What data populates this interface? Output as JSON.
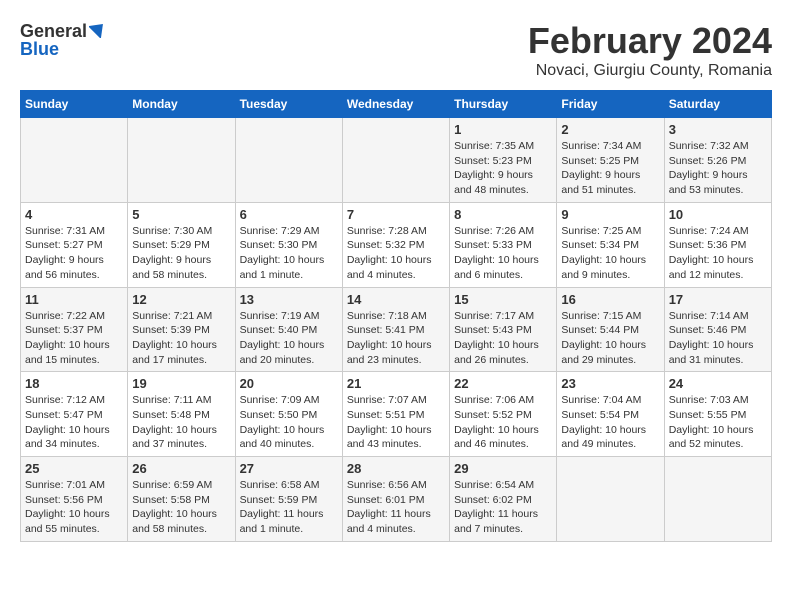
{
  "header": {
    "logo": {
      "general": "General",
      "blue": "Blue"
    },
    "title": "February 2024",
    "location": "Novaci, Giurgiu County, Romania"
  },
  "calendar": {
    "days_of_week": [
      "Sunday",
      "Monday",
      "Tuesday",
      "Wednesday",
      "Thursday",
      "Friday",
      "Saturday"
    ],
    "weeks": [
      [
        {
          "day": "",
          "info": ""
        },
        {
          "day": "",
          "info": ""
        },
        {
          "day": "",
          "info": ""
        },
        {
          "day": "",
          "info": ""
        },
        {
          "day": "1",
          "info": "Sunrise: 7:35 AM\nSunset: 5:23 PM\nDaylight: 9 hours and 48 minutes."
        },
        {
          "day": "2",
          "info": "Sunrise: 7:34 AM\nSunset: 5:25 PM\nDaylight: 9 hours and 51 minutes."
        },
        {
          "day": "3",
          "info": "Sunrise: 7:32 AM\nSunset: 5:26 PM\nDaylight: 9 hours and 53 minutes."
        }
      ],
      [
        {
          "day": "4",
          "info": "Sunrise: 7:31 AM\nSunset: 5:27 PM\nDaylight: 9 hours and 56 minutes."
        },
        {
          "day": "5",
          "info": "Sunrise: 7:30 AM\nSunset: 5:29 PM\nDaylight: 9 hours and 58 minutes."
        },
        {
          "day": "6",
          "info": "Sunrise: 7:29 AM\nSunset: 5:30 PM\nDaylight: 10 hours and 1 minute."
        },
        {
          "day": "7",
          "info": "Sunrise: 7:28 AM\nSunset: 5:32 PM\nDaylight: 10 hours and 4 minutes."
        },
        {
          "day": "8",
          "info": "Sunrise: 7:26 AM\nSunset: 5:33 PM\nDaylight: 10 hours and 6 minutes."
        },
        {
          "day": "9",
          "info": "Sunrise: 7:25 AM\nSunset: 5:34 PM\nDaylight: 10 hours and 9 minutes."
        },
        {
          "day": "10",
          "info": "Sunrise: 7:24 AM\nSunset: 5:36 PM\nDaylight: 10 hours and 12 minutes."
        }
      ],
      [
        {
          "day": "11",
          "info": "Sunrise: 7:22 AM\nSunset: 5:37 PM\nDaylight: 10 hours and 15 minutes."
        },
        {
          "day": "12",
          "info": "Sunrise: 7:21 AM\nSunset: 5:39 PM\nDaylight: 10 hours and 17 minutes."
        },
        {
          "day": "13",
          "info": "Sunrise: 7:19 AM\nSunset: 5:40 PM\nDaylight: 10 hours and 20 minutes."
        },
        {
          "day": "14",
          "info": "Sunrise: 7:18 AM\nSunset: 5:41 PM\nDaylight: 10 hours and 23 minutes."
        },
        {
          "day": "15",
          "info": "Sunrise: 7:17 AM\nSunset: 5:43 PM\nDaylight: 10 hours and 26 minutes."
        },
        {
          "day": "16",
          "info": "Sunrise: 7:15 AM\nSunset: 5:44 PM\nDaylight: 10 hours and 29 minutes."
        },
        {
          "day": "17",
          "info": "Sunrise: 7:14 AM\nSunset: 5:46 PM\nDaylight: 10 hours and 31 minutes."
        }
      ],
      [
        {
          "day": "18",
          "info": "Sunrise: 7:12 AM\nSunset: 5:47 PM\nDaylight: 10 hours and 34 minutes."
        },
        {
          "day": "19",
          "info": "Sunrise: 7:11 AM\nSunset: 5:48 PM\nDaylight: 10 hours and 37 minutes."
        },
        {
          "day": "20",
          "info": "Sunrise: 7:09 AM\nSunset: 5:50 PM\nDaylight: 10 hours and 40 minutes."
        },
        {
          "day": "21",
          "info": "Sunrise: 7:07 AM\nSunset: 5:51 PM\nDaylight: 10 hours and 43 minutes."
        },
        {
          "day": "22",
          "info": "Sunrise: 7:06 AM\nSunset: 5:52 PM\nDaylight: 10 hours and 46 minutes."
        },
        {
          "day": "23",
          "info": "Sunrise: 7:04 AM\nSunset: 5:54 PM\nDaylight: 10 hours and 49 minutes."
        },
        {
          "day": "24",
          "info": "Sunrise: 7:03 AM\nSunset: 5:55 PM\nDaylight: 10 hours and 52 minutes."
        }
      ],
      [
        {
          "day": "25",
          "info": "Sunrise: 7:01 AM\nSunset: 5:56 PM\nDaylight: 10 hours and 55 minutes."
        },
        {
          "day": "26",
          "info": "Sunrise: 6:59 AM\nSunset: 5:58 PM\nDaylight: 10 hours and 58 minutes."
        },
        {
          "day": "27",
          "info": "Sunrise: 6:58 AM\nSunset: 5:59 PM\nDaylight: 11 hours and 1 minute."
        },
        {
          "day": "28",
          "info": "Sunrise: 6:56 AM\nSunset: 6:01 PM\nDaylight: 11 hours and 4 minutes."
        },
        {
          "day": "29",
          "info": "Sunrise: 6:54 AM\nSunset: 6:02 PM\nDaylight: 11 hours and 7 minutes."
        },
        {
          "day": "",
          "info": ""
        },
        {
          "day": "",
          "info": ""
        }
      ]
    ]
  }
}
